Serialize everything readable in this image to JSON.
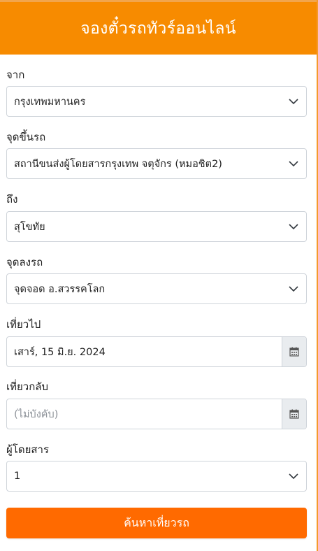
{
  "header": {
    "title": "จองตั๋วรถทัวร์ออนไลน์"
  },
  "form": {
    "origin": {
      "label": "จาก",
      "value": "กรุงเทพมหานคร"
    },
    "pickup": {
      "label": "จุดขึ้นรถ",
      "value": "สถานีขนส่งผู้โดยสารกรุงเทพ จตุจักร (หมอชิต2)"
    },
    "destination": {
      "label": "ถึง",
      "value": "สุโขทัย"
    },
    "dropoff": {
      "label": "จุดลงรถ",
      "value": "จุดจอด อ.สวรรคโลก"
    },
    "depart_date": {
      "label": "เที่ยวไป",
      "value": "เสาร์, 15 มิ.ย. 2024"
    },
    "return_date": {
      "label": "เที่ยวกลับ",
      "placeholder": "(ไม่บังคับ)"
    },
    "passengers": {
      "label": "ผู้โดยสาร",
      "value": "1"
    },
    "submit_label": "ค้นหาเที่ยวรถ"
  },
  "colors": {
    "header_bg": "#f78b00",
    "button_bg": "#ff6a00",
    "addon_bg": "#e9ecef"
  }
}
